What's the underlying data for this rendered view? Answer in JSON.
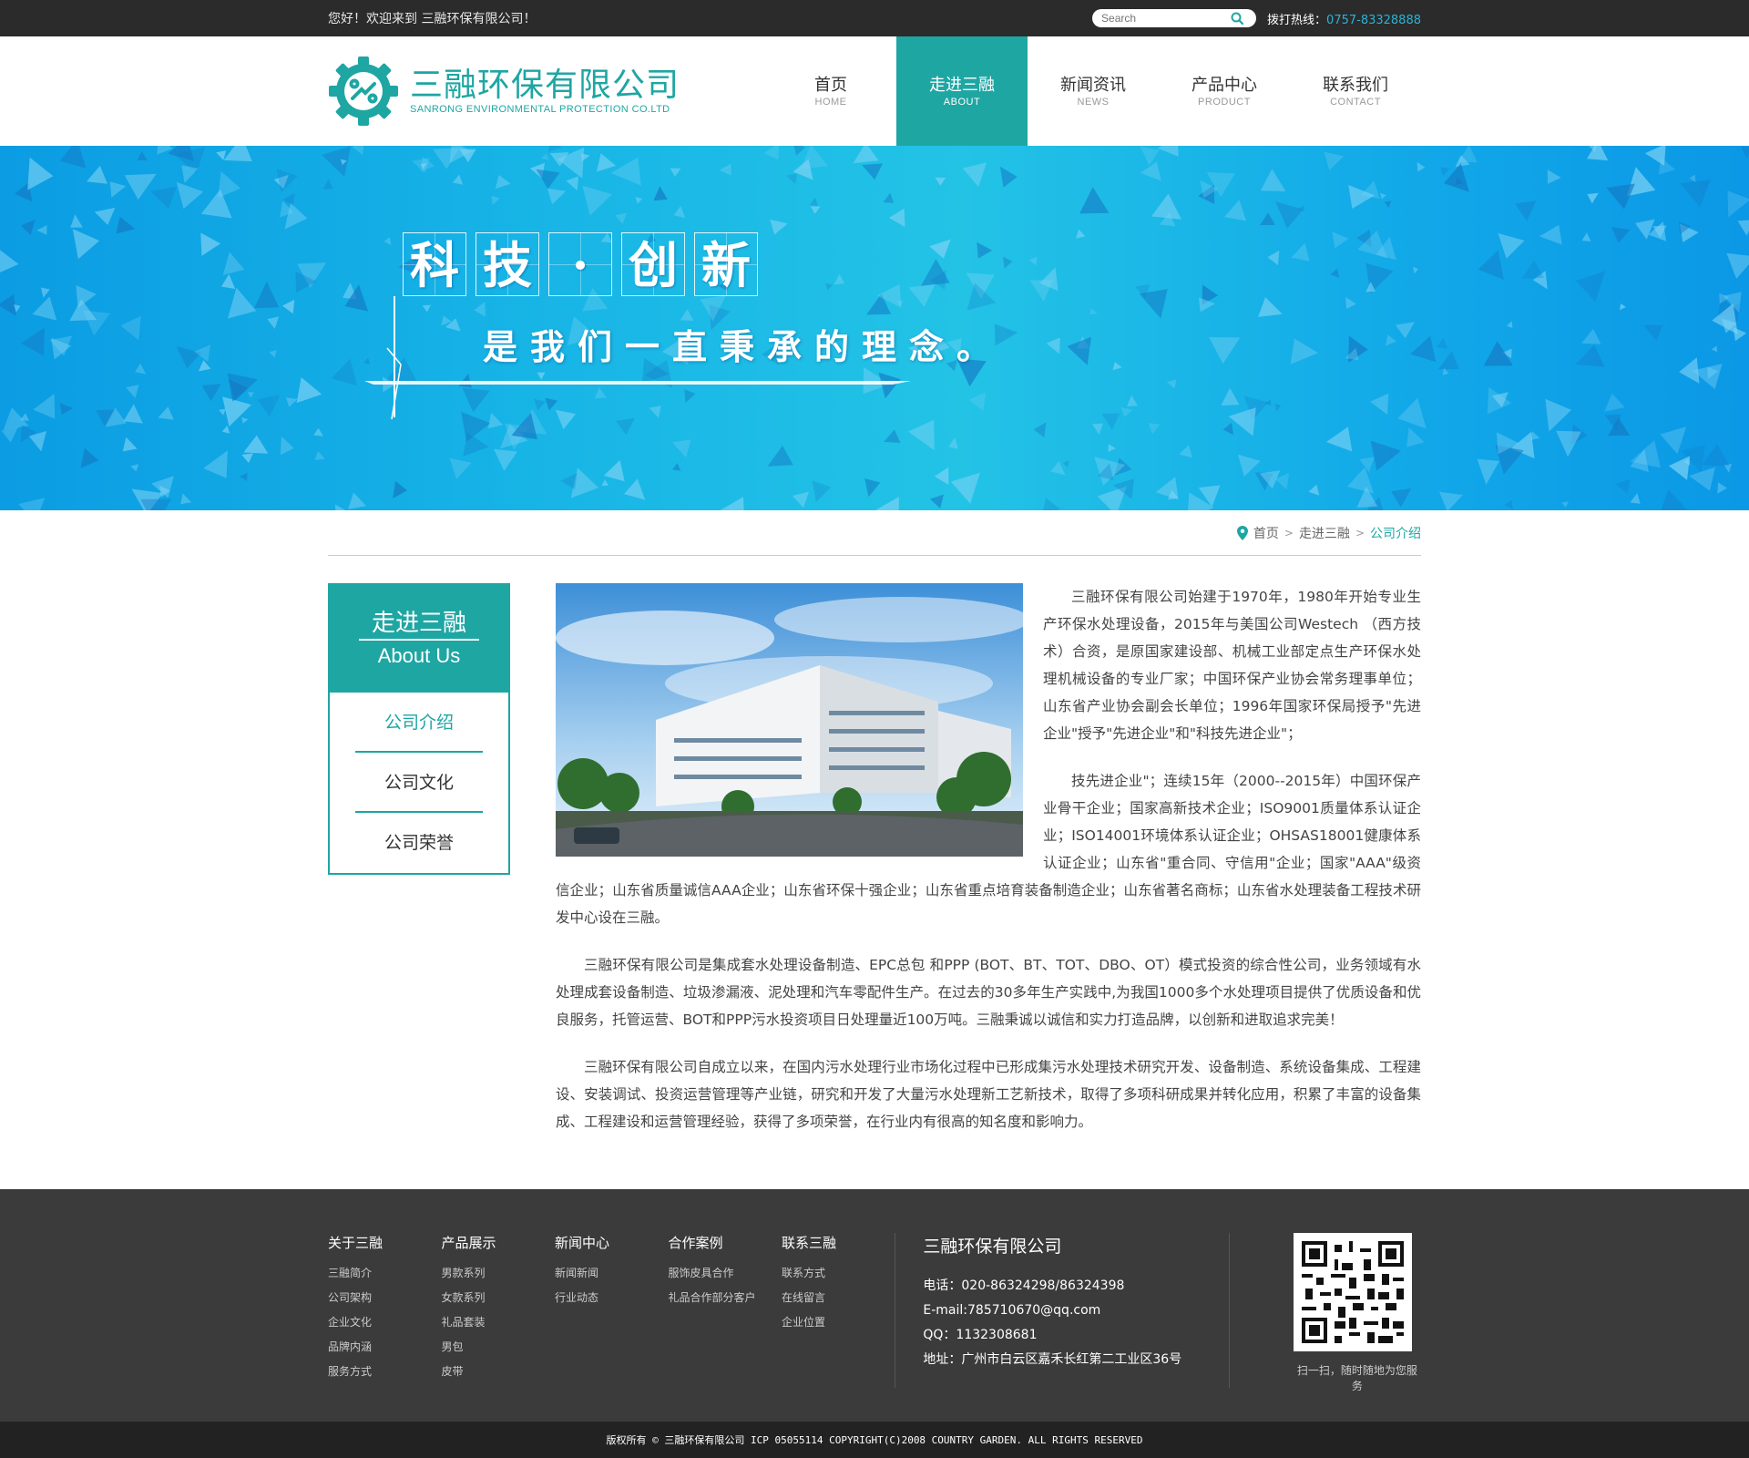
{
  "topbar": {
    "welcome": "您好！欢迎来到  三融环保有限公司！",
    "search_placeholder": "Search",
    "hotline_label": "拨打热线：",
    "hotline_number": "0757-83328888"
  },
  "logo": {
    "cn": "三融环保有限公司",
    "en": "SANRONG ENVIRONMENTAL PROTECTION CO.LTD"
  },
  "nav": [
    {
      "cn": "首页",
      "en": "HOME",
      "active": false
    },
    {
      "cn": "走进三融",
      "en": "ABOUT",
      "active": true
    },
    {
      "cn": "新闻资讯",
      "en": "NEWS",
      "active": false
    },
    {
      "cn": "产品中心",
      "en": "PRODUCT",
      "active": false
    },
    {
      "cn": "联系我们",
      "en": "CONTACT",
      "active": false
    }
  ],
  "banner": {
    "chars": [
      "科",
      "技",
      "·",
      "创",
      "新"
    ],
    "subtitle": "是我们一直秉承的理念。"
  },
  "breadcrumb": {
    "home": "首页",
    "section": "走进三融",
    "current": "公司介绍"
  },
  "sidebar": {
    "title_cn": "走进三融",
    "title_en": "About Us",
    "items": [
      {
        "label": "公司介绍",
        "active": true
      },
      {
        "label": "公司文化",
        "active": false
      },
      {
        "label": "公司荣誉",
        "active": false
      }
    ]
  },
  "content": {
    "paragraphs": [
      "三融环保有限公司始建于1970年，1980年开始专业生产环保水处理设备，2015年与美国公司Westech （西方技术）合资，是原国家建设部、机械工业部定点生产环保水处理机械设备的专业厂家；中国环保产业协会常务理事单位；山东省产业协会副会长单位；1996年国家环保局授予\"先进企业\"授予\"先进企业\"和\"科技先进企业\"；",
      "技先进企业\"；连续15年（2000--2015年）中国环保产业骨干企业；国家高新技术企业；ISO9001质量体系认证企业；ISO14001环境体系认证企业；OHSAS18001健康体系认证企业；山东省\"重合同、守信用\"企业；国家\"AAA\"级资信企业；山东省质量诚信AAA企业；山东省环保十强企业；山东省重点培育装备制造企业；山东省著名商标；山东省水处理装备工程技术研发中心设在三融。",
      "三融环保有限公司是集成套水处理设备制造、EPC总包 和PPP (BOT、BT、TOT、DBO、OT）模式投资的综合性公司，业务领域有水处理成套设备制造、垃圾渗漏液、泥处理和汽车零配件生产。在过去的30多年生产实践中,为我国1000多个水处理项目提供了优质设备和优良服务，托管运营、BOT和PPP污水投资项目日处理量近100万吨。三融秉诚以诚信和实力打造品牌，以创新和进取追求完美！",
      "三融环保有限公司自成立以来，在国内污水处理行业市场化过程中已形成集污水处理技术研究开发、设备制造、系统设备集成、工程建设、安装调试、投资运营管理等产业链，研究和开发了大量污水处理新工艺新技术，取得了多项科研成果并转化应用，积累了丰富的设备集成、工程建设和运营管理经验，获得了多项荣誉，在行业内有很高的知名度和影响力。"
    ]
  },
  "footer": {
    "columns": [
      {
        "title": "关于三融",
        "links": [
          "三融简介",
          "公司架构",
          "企业文化",
          "品牌内涵",
          "服务方式"
        ]
      },
      {
        "title": "产品展示",
        "links": [
          "男款系列",
          "女款系列",
          "礼品套装",
          "男包",
          "皮带"
        ]
      },
      {
        "title": "新闻中心",
        "links": [
          "新闻新闻",
          "行业动态"
        ]
      },
      {
        "title": "合作案例",
        "links": [
          "服饰皮具合作",
          "礼品合作部分客户"
        ]
      },
      {
        "title": "联系三融",
        "links": [
          "联系方式",
          "在线留言",
          "企业位置"
        ]
      }
    ],
    "company": "三融环保有限公司",
    "phone": "电话：020-86324298/86324398",
    "email": "E-mail:785710670@qq.com",
    "qq": "QQ：1132308681",
    "address": "地址：广州市白云区嘉禾长红第二工业区36号",
    "qr_caption": "扫一扫，随时随地为您服务",
    "copyright": "版权所有 © 三融环保有限公司  ICP 05055114 COPYRIGHT(C)2008 COUNTRY GARDEN. ALL RIGHTS RESERVED"
  },
  "colors": {
    "accent": "#1ea6a3",
    "topbar_bg": "#2b2b2b",
    "footer_bg": "#3b3b3b",
    "hotline": "#2bb3d6"
  }
}
